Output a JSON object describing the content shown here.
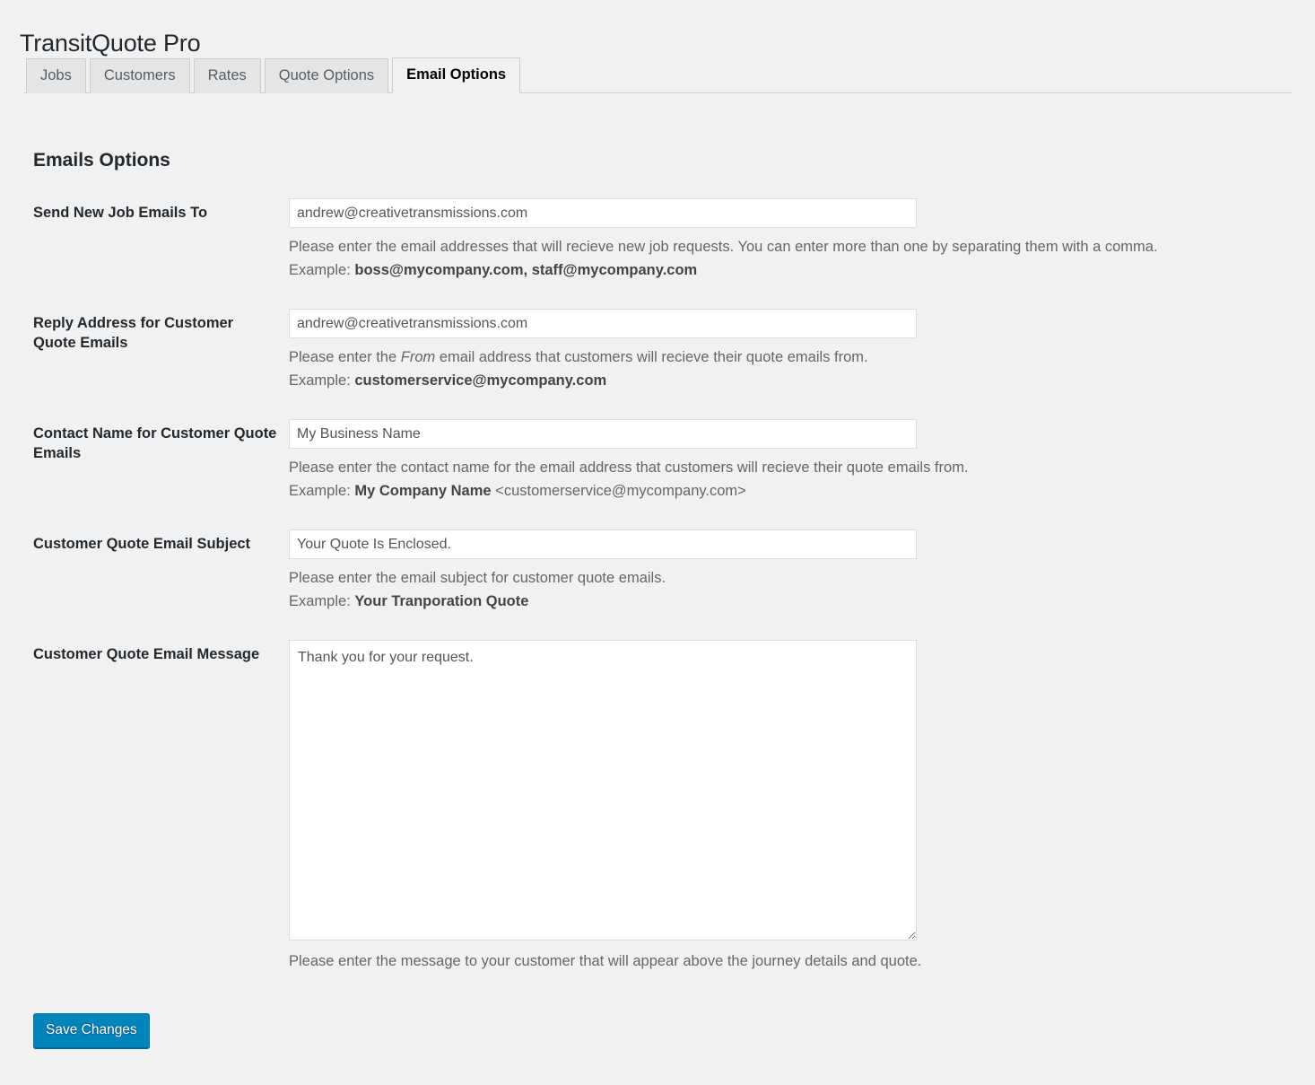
{
  "app": {
    "title": "TransitQuote Pro"
  },
  "tabs": [
    {
      "label": "Jobs",
      "active": false
    },
    {
      "label": "Customers",
      "active": false
    },
    {
      "label": "Rates",
      "active": false
    },
    {
      "label": "Quote Options",
      "active": false
    },
    {
      "label": "Email Options",
      "active": true
    }
  ],
  "section": {
    "heading": "Emails Options"
  },
  "fields": {
    "send_new_job_emails_to": {
      "label": "Send New Job Emails To",
      "value": "andrew@creativetransmissions.com",
      "placeholder": "",
      "desc_line1": "Please enter the email addresses that will recieve new job requests. You can enter more than one by separating them with a comma.",
      "desc_line2_prefix": "Example: ",
      "desc_line2_bold": "boss@mycompany.com, staff@mycompany.com",
      "desc_line2_suffix": ""
    },
    "reply_address": {
      "label": "Reply Address for Customer Quote Emails",
      "value": "andrew@creativetransmissions.com",
      "placeholder": "",
      "desc_line1_prefix": "Please enter the ",
      "desc_line1_italic": "From",
      "desc_line1_suffix": " email address that customers will recieve their quote emails from.",
      "desc_line2_prefix": "Example: ",
      "desc_line2_bold": "customerservice@mycompany.com",
      "desc_line2_suffix": ""
    },
    "contact_name": {
      "label": "Contact Name for Customer Quote Emails",
      "value": "My Business Name",
      "placeholder": "",
      "desc_line1": "Please enter the contact name for the email address that customers will recieve their quote emails from.",
      "desc_line2_prefix": "Example: ",
      "desc_line2_bold": "My Company Name",
      "desc_line2_suffix": " <customerservice@mycompany.com>"
    },
    "email_subject": {
      "label": "Customer Quote Email Subject",
      "value": "Your Quote Is Enclosed.",
      "placeholder": "",
      "desc_line1": "Please enter the email subject for customer quote emails.",
      "desc_line2_prefix": "Example: ",
      "desc_line2_bold": "Your Tranporation Quote",
      "desc_line2_suffix": ""
    },
    "email_message": {
      "label": "Customer Quote Email Message",
      "value": "Thank you for your request.",
      "placeholder": "",
      "desc_line1": "Please enter the message to your customer that will appear above the journey details and quote."
    }
  },
  "submit": {
    "save_label": "Save Changes"
  },
  "colors": {
    "page_background": "#f1f1f1",
    "primary_button": "#0085ba",
    "label_text": "#23282d",
    "description_text": "#666666",
    "tab_inactive_bg": "#e5e5e5",
    "tab_border": "#cccccc",
    "input_border": "#dddddd"
  }
}
